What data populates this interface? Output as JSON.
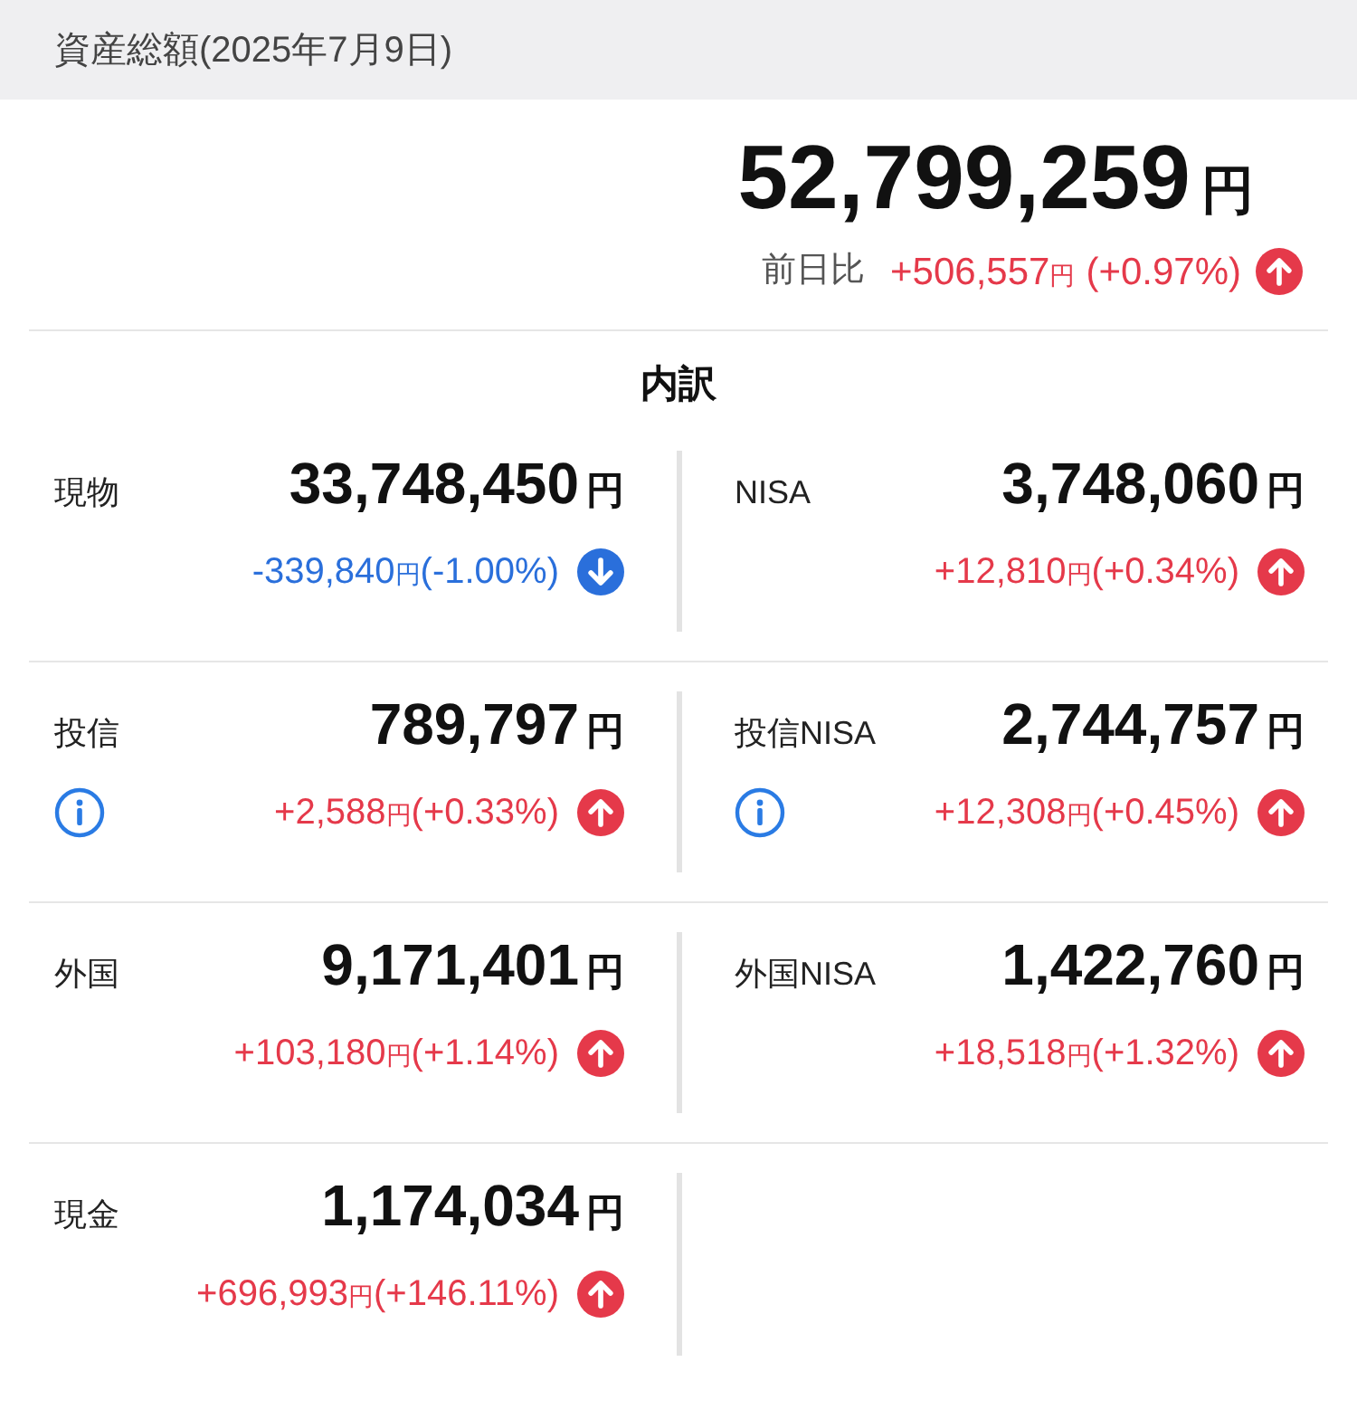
{
  "header": {
    "title": "資産総額(2025年7月9日)"
  },
  "total": {
    "amount": "52,799,259",
    "unit": "円",
    "compare_label": "前日比",
    "change": "+506,557",
    "change_unit": "円",
    "pct": "(+0.97%)",
    "rising": true
  },
  "breakdown": {
    "title": "内訳",
    "rows": [
      [
        {
          "label": "現物",
          "amount": "33,748,450",
          "unit": "円",
          "change": "-339,840",
          "change_unit": "円",
          "pct": "(-1.00%)",
          "rising": false,
          "info": false
        },
        {
          "label": "NISA",
          "amount": "3,748,060",
          "unit": "円",
          "change": "+12,810",
          "change_unit": "円",
          "pct": "(+0.34%)",
          "rising": true,
          "info": false
        }
      ],
      [
        {
          "label": "投信",
          "amount": "789,797",
          "unit": "円",
          "change": "+2,588",
          "change_unit": "円",
          "pct": "(+0.33%)",
          "rising": true,
          "info": true
        },
        {
          "label": "投信NISA",
          "amount": "2,744,757",
          "unit": "円",
          "change": "+12,308",
          "change_unit": "円",
          "pct": "(+0.45%)",
          "rising": true,
          "info": true
        }
      ],
      [
        {
          "label": "外国",
          "amount": "9,171,401",
          "unit": "円",
          "change": "+103,180",
          "change_unit": "円",
          "pct": "(+1.14%)",
          "rising": true,
          "info": false
        },
        {
          "label": "外国NISA",
          "amount": "1,422,760",
          "unit": "円",
          "change": "+18,518",
          "change_unit": "円",
          "pct": "(+1.32%)",
          "rising": true,
          "info": false
        }
      ],
      [
        {
          "label": "現金",
          "amount": "1,174,034",
          "unit": "円",
          "change": "+696,993",
          "change_unit": "円",
          "pct": "(+146.11%)",
          "rising": true,
          "info": false
        }
      ]
    ]
  }
}
